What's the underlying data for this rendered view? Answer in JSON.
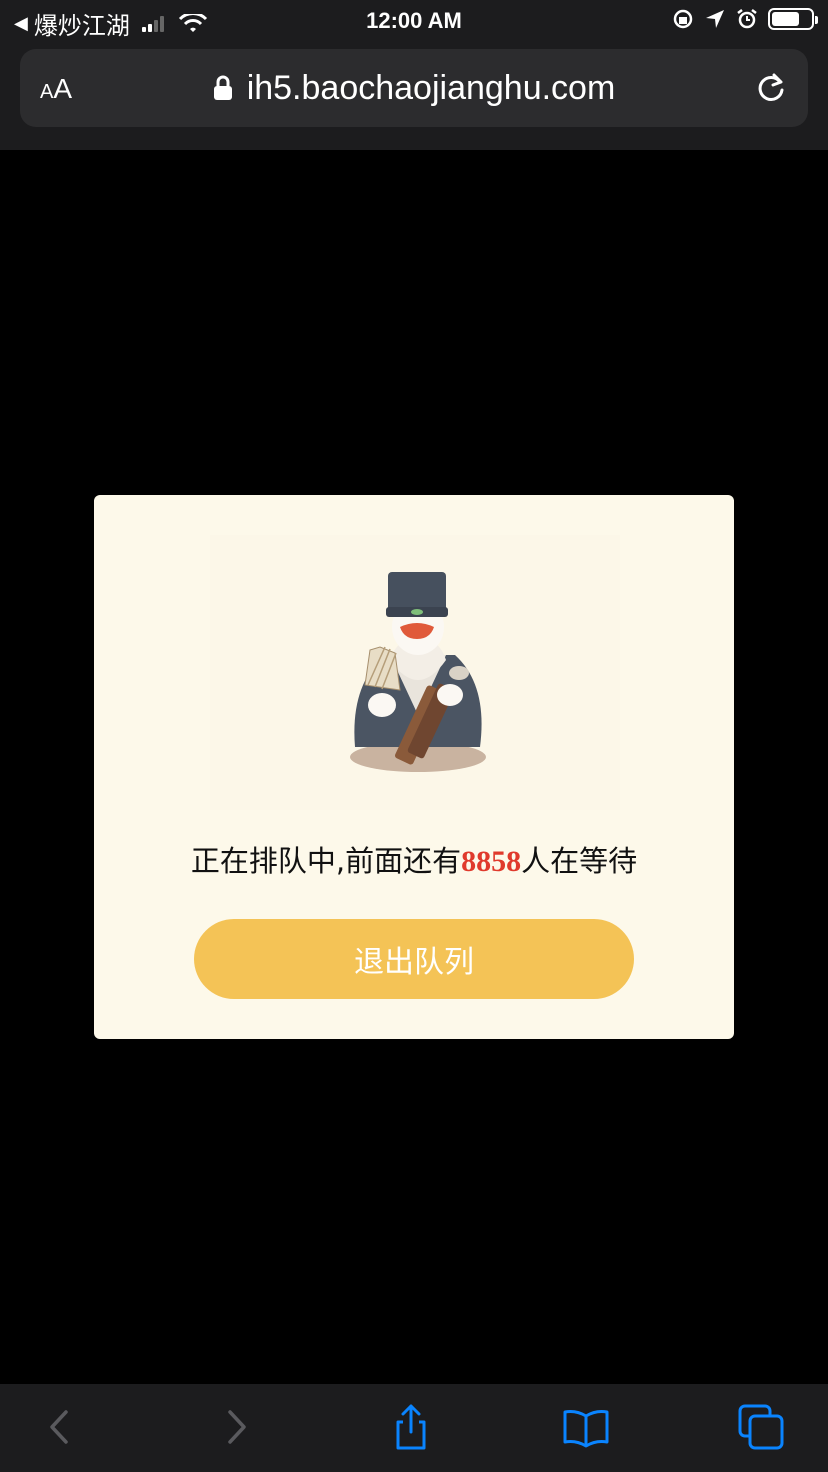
{
  "status_bar": {
    "back_app": "爆炒江湖",
    "time": "12:00 AM"
  },
  "address_bar": {
    "text_size_button": "AA",
    "url": "ih5.baochaojianghu.com"
  },
  "modal": {
    "queue_prefix": "正在排队中,前面还有",
    "queue_count": "8858",
    "queue_suffix": "人在等待",
    "exit_button_label": "退出队列"
  },
  "colors": {
    "accent_button": "#f4c356",
    "count_red": "#e03a2c",
    "modal_bg": "#fdf9ea",
    "toolbar_icon_active": "#0a84ff",
    "toolbar_icon_disabled": "#5a5a5e"
  },
  "toolbar": {
    "icons": [
      "back-icon",
      "forward-icon",
      "share-icon",
      "bookmarks-icon",
      "tabs-icon"
    ]
  }
}
